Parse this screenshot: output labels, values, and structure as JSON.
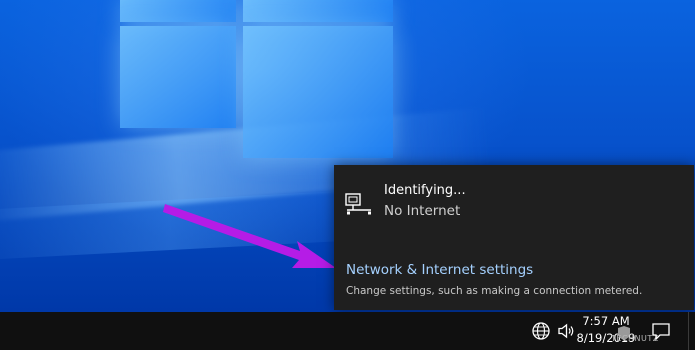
{
  "network_flyout": {
    "network_name": "Identifying...",
    "network_status": "No Internet",
    "settings_link": "Network & Internet settings",
    "settings_description": "Change settings, such as making a connection metered."
  },
  "taskbar": {
    "tray_icons": [
      "globe-network-icon",
      "speaker-icon",
      "shield-icon",
      "action-center-icon"
    ],
    "clock_time": "7:57 AM",
    "clock_date": "8/19/2019"
  },
  "watermark": "TECHNUTZ",
  "colors": {
    "desktop_blue": "#0752cc",
    "flyout_bg": "#1f1f1f",
    "link_blue": "#a5d1ff",
    "annotation_arrow": "#b51ce6",
    "taskbar_bg": "#101010"
  }
}
